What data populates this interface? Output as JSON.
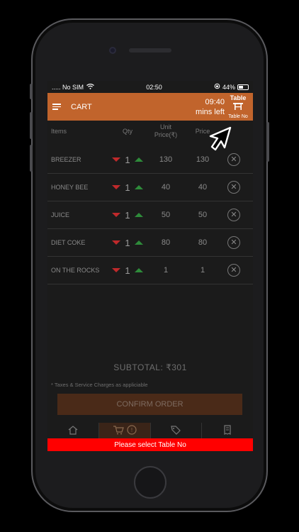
{
  "status": {
    "carrier": "..... No SIM",
    "time": "02:50",
    "battery": "44%"
  },
  "appbar": {
    "title": "CART",
    "timer_time": "09:40",
    "timer_label": "mins left",
    "table_title": "Table",
    "table_sub": "Table No"
  },
  "columns": {
    "items": "Items",
    "qty": "Qty",
    "unit_line1": "Unit",
    "unit_line2": "Price(₹)",
    "price": "Price"
  },
  "rows": [
    {
      "name": "BREEZER",
      "qty": "1",
      "unit": "130",
      "price": "130"
    },
    {
      "name": "HONEY BEE",
      "qty": "1",
      "unit": "40",
      "price": "40"
    },
    {
      "name": "JUICE",
      "qty": "1",
      "unit": "50",
      "price": "50"
    },
    {
      "name": "DIET COKE",
      "qty": "1",
      "unit": "80",
      "price": "80"
    },
    {
      "name": "ON THE ROCKS",
      "qty": "1",
      "unit": "1",
      "price": "1"
    }
  ],
  "subtotal": {
    "label": "SUBTOTAL:",
    "value": "₹301"
  },
  "tax_note": "* Taxes & Service Charges as appliciable",
  "confirm_label": "CONFIRM ORDER",
  "tabs": [
    {
      "icon": "home-icon",
      "badge": ""
    },
    {
      "icon": "cart-icon",
      "badge": "!"
    },
    {
      "icon": "tag-icon",
      "badge": ""
    },
    {
      "icon": "bill-icon",
      "badge": ""
    }
  ],
  "toast": "Please select Table No",
  "colors": {
    "accent": "#c1642c",
    "background": "#1b1b1b",
    "toast": "#ff0000",
    "decrease": "#c0292b",
    "increase": "#2e8b3a"
  }
}
